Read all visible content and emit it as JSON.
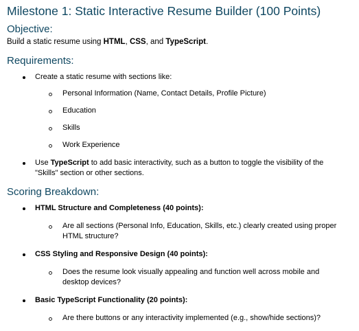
{
  "title": "Milestone 1: Static Interactive Resume Builder (100 Points)",
  "objective": {
    "heading": "Objective:",
    "text_prefix": "Build a static resume using ",
    "html": "HTML",
    "sep1": ", ",
    "css": "CSS",
    "sep2": ", and ",
    "ts": "TypeScript",
    "suffix": "."
  },
  "requirements": {
    "heading": "Requirements:",
    "item1": "Create a static resume with sections like:",
    "subitems": [
      "Personal Information (Name, Contact Details, Profile Picture)",
      "Education",
      "Skills",
      "Work Experience"
    ],
    "item2_prefix": "Use ",
    "item2_bold": "TypeScript",
    "item2_rest": " to add basic interactivity, such as a button to toggle the visibility of the",
    "item2_line2": "\"Skills\" section or other sections."
  },
  "scoring": {
    "heading": "Scoring Breakdown:",
    "items": [
      {
        "title": "HTML Structure and Completeness (40 points):",
        "q1": "Are all sections (Personal Info, Education, Skills, etc.) clearly created using proper",
        "q2": "HTML structure?"
      },
      {
        "title": "CSS Styling and Responsive Design (40 points):",
        "q1": "Does the resume look visually appealing and function well across mobile and",
        "q2": "desktop devices?"
      },
      {
        "title": "Basic TypeScript Functionality (20 points):",
        "q1": "Are there buttons or any interactivity implemented (e.g., show/hide sections)?"
      }
    ]
  }
}
